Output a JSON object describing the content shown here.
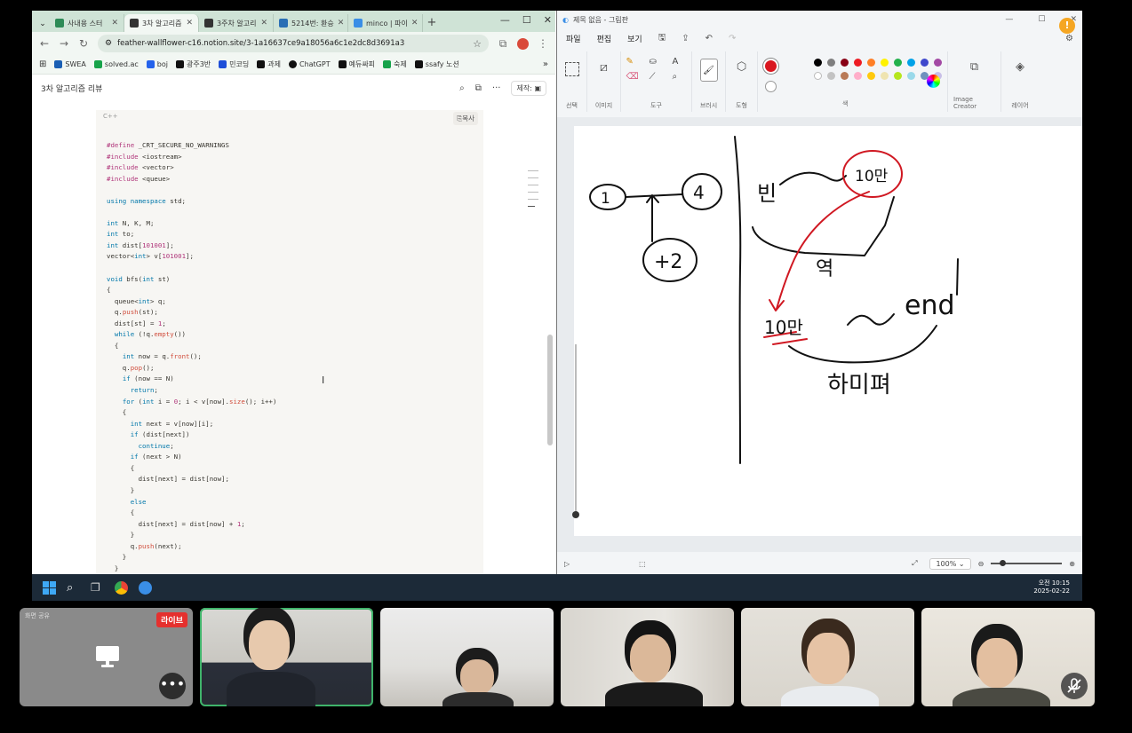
{
  "chrome": {
    "tabs": [
      {
        "label": "사내용 스터",
        "color": "#2e8b57"
      },
      {
        "label": "3차 알고리즘",
        "color": "#333333",
        "active": true
      },
      {
        "label": "3주차 알고리",
        "color": "#333333"
      },
      {
        "label": "5214번: 환승",
        "color": "#2a6fb5"
      },
      {
        "label": "minco | 파이",
        "color": "#3a8ee6"
      }
    ],
    "new_tab": "+",
    "url": "feather-wallflower-c16.notion.site/3-1a16637ce9a18056a6c1e2dc8d3691a3",
    "bookmarks": [
      {
        "label": "SWEA",
        "color": "#1a5fb4"
      },
      {
        "label": "solved.ac",
        "color": "#17a34a"
      },
      {
        "label": "boj",
        "color": "#2563eb"
      },
      {
        "label": "광주3반",
        "color": "#111111"
      },
      {
        "label": "민코딩",
        "color": "#1d4ed8"
      },
      {
        "label": "과제",
        "color": "#111111"
      },
      {
        "label": "ChatGPT",
        "color": "#111111"
      },
      {
        "label": "예듀싸피",
        "color": "#111111"
      },
      {
        "label": "숙제",
        "color": "#16a34a"
      },
      {
        "label": "ssafy 노션",
        "color": "#111111"
      }
    ],
    "page_title": "3차 알고리즘 리뷰",
    "make_button": "제작:",
    "code_lang": "C++",
    "copy_label": "복사"
  },
  "code": [
    "#define _CRT_SECURE_NO_WARNINGS",
    "#include <iostream>",
    "#include <vector>",
    "#include <queue>",
    "",
    "using namespace std;",
    "",
    "int N, K, M;",
    "int to;",
    "int dist[101001];",
    "vector<int> v[101001];",
    "",
    "void bfs(int st)",
    "{",
    "  queue<int> q;",
    "  q.push(st);",
    "  dist[st] = 1;",
    "  while (!q.empty())",
    "  {",
    "    int now = q.front();",
    "    q.pop();",
    "    if (now == N)",
    "      return;",
    "    for (int i = 0; i < v[now].size(); i++)",
    "    {",
    "      int next = v[now][i];",
    "      if (dist[next])",
    "        continue;",
    "      if (next > N)",
    "      {",
    "        dist[next] = dist[now];",
    "      }",
    "      else",
    "      {",
    "        dist[next] = dist[now] + 1;",
    "      }",
    "      q.push(next);",
    "    }",
    "  }",
    "}"
  ],
  "paint": {
    "title": "제목 없음 - 그림판",
    "menu": [
      "파일",
      "편집",
      "보기"
    ],
    "groups": [
      "선택",
      "이미지",
      "도구",
      "브러시",
      "도형",
      "색",
      "Image Creator",
      "레이어"
    ],
    "current_color": "#d9161f",
    "palette": [
      "#000000",
      "#7f7f7f",
      "#880015",
      "#ed1c24",
      "#ff7f27",
      "#fff200",
      "#22b14c",
      "#00a2e8",
      "#3f48cc",
      "#a349a4",
      "#ffffff",
      "#c3c3c3",
      "#b97a57",
      "#ffaec9",
      "#ffc90e",
      "#efe4b0",
      "#b5e61d",
      "#99d9ea",
      "#7092be",
      "#c8bfe7"
    ],
    "zoom": "100%",
    "notification": "!"
  },
  "drawing": {
    "text": [
      "1",
      "4",
      "+2",
      "빈",
      "10만",
      "역",
      "10만",
      "end",
      "하미펴"
    ]
  },
  "taskbar": {
    "time": "오전 10:15",
    "date": "2025-02-22"
  },
  "tiles": {
    "live_label": "라이브",
    "more": "•••",
    "screen_caption": "화면 공유"
  }
}
